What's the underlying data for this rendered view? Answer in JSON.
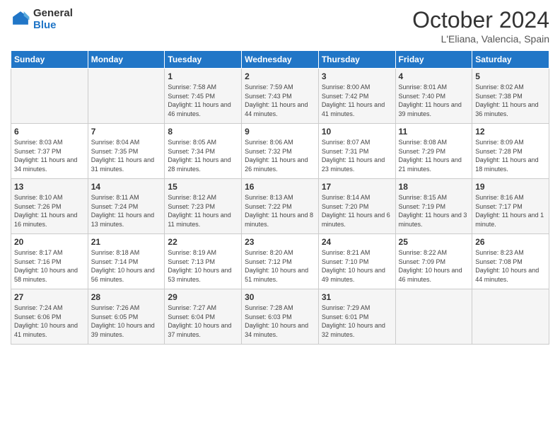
{
  "logo": {
    "line1": "General",
    "line2": "Blue"
  },
  "title": "October 2024",
  "subtitle": "L'Eliana, Valencia, Spain",
  "days_of_week": [
    "Sunday",
    "Monday",
    "Tuesday",
    "Wednesday",
    "Thursday",
    "Friday",
    "Saturday"
  ],
  "weeks": [
    [
      {
        "day": "",
        "info": ""
      },
      {
        "day": "",
        "info": ""
      },
      {
        "day": "1",
        "info": "Sunrise: 7:58 AM\nSunset: 7:45 PM\nDaylight: 11 hours and 46 minutes."
      },
      {
        "day": "2",
        "info": "Sunrise: 7:59 AM\nSunset: 7:43 PM\nDaylight: 11 hours and 44 minutes."
      },
      {
        "day": "3",
        "info": "Sunrise: 8:00 AM\nSunset: 7:42 PM\nDaylight: 11 hours and 41 minutes."
      },
      {
        "day": "4",
        "info": "Sunrise: 8:01 AM\nSunset: 7:40 PM\nDaylight: 11 hours and 39 minutes."
      },
      {
        "day": "5",
        "info": "Sunrise: 8:02 AM\nSunset: 7:38 PM\nDaylight: 11 hours and 36 minutes."
      }
    ],
    [
      {
        "day": "6",
        "info": "Sunrise: 8:03 AM\nSunset: 7:37 PM\nDaylight: 11 hours and 34 minutes."
      },
      {
        "day": "7",
        "info": "Sunrise: 8:04 AM\nSunset: 7:35 PM\nDaylight: 11 hours and 31 minutes."
      },
      {
        "day": "8",
        "info": "Sunrise: 8:05 AM\nSunset: 7:34 PM\nDaylight: 11 hours and 28 minutes."
      },
      {
        "day": "9",
        "info": "Sunrise: 8:06 AM\nSunset: 7:32 PM\nDaylight: 11 hours and 26 minutes."
      },
      {
        "day": "10",
        "info": "Sunrise: 8:07 AM\nSunset: 7:31 PM\nDaylight: 11 hours and 23 minutes."
      },
      {
        "day": "11",
        "info": "Sunrise: 8:08 AM\nSunset: 7:29 PM\nDaylight: 11 hours and 21 minutes."
      },
      {
        "day": "12",
        "info": "Sunrise: 8:09 AM\nSunset: 7:28 PM\nDaylight: 11 hours and 18 minutes."
      }
    ],
    [
      {
        "day": "13",
        "info": "Sunrise: 8:10 AM\nSunset: 7:26 PM\nDaylight: 11 hours and 16 minutes."
      },
      {
        "day": "14",
        "info": "Sunrise: 8:11 AM\nSunset: 7:24 PM\nDaylight: 11 hours and 13 minutes."
      },
      {
        "day": "15",
        "info": "Sunrise: 8:12 AM\nSunset: 7:23 PM\nDaylight: 11 hours and 11 minutes."
      },
      {
        "day": "16",
        "info": "Sunrise: 8:13 AM\nSunset: 7:22 PM\nDaylight: 11 hours and 8 minutes."
      },
      {
        "day": "17",
        "info": "Sunrise: 8:14 AM\nSunset: 7:20 PM\nDaylight: 11 hours and 6 minutes."
      },
      {
        "day": "18",
        "info": "Sunrise: 8:15 AM\nSunset: 7:19 PM\nDaylight: 11 hours and 3 minutes."
      },
      {
        "day": "19",
        "info": "Sunrise: 8:16 AM\nSunset: 7:17 PM\nDaylight: 11 hours and 1 minute."
      }
    ],
    [
      {
        "day": "20",
        "info": "Sunrise: 8:17 AM\nSunset: 7:16 PM\nDaylight: 10 hours and 58 minutes."
      },
      {
        "day": "21",
        "info": "Sunrise: 8:18 AM\nSunset: 7:14 PM\nDaylight: 10 hours and 56 minutes."
      },
      {
        "day": "22",
        "info": "Sunrise: 8:19 AM\nSunset: 7:13 PM\nDaylight: 10 hours and 53 minutes."
      },
      {
        "day": "23",
        "info": "Sunrise: 8:20 AM\nSunset: 7:12 PM\nDaylight: 10 hours and 51 minutes."
      },
      {
        "day": "24",
        "info": "Sunrise: 8:21 AM\nSunset: 7:10 PM\nDaylight: 10 hours and 49 minutes."
      },
      {
        "day": "25",
        "info": "Sunrise: 8:22 AM\nSunset: 7:09 PM\nDaylight: 10 hours and 46 minutes."
      },
      {
        "day": "26",
        "info": "Sunrise: 8:23 AM\nSunset: 7:08 PM\nDaylight: 10 hours and 44 minutes."
      }
    ],
    [
      {
        "day": "27",
        "info": "Sunrise: 7:24 AM\nSunset: 6:06 PM\nDaylight: 10 hours and 41 minutes."
      },
      {
        "day": "28",
        "info": "Sunrise: 7:26 AM\nSunset: 6:05 PM\nDaylight: 10 hours and 39 minutes."
      },
      {
        "day": "29",
        "info": "Sunrise: 7:27 AM\nSunset: 6:04 PM\nDaylight: 10 hours and 37 minutes."
      },
      {
        "day": "30",
        "info": "Sunrise: 7:28 AM\nSunset: 6:03 PM\nDaylight: 10 hours and 34 minutes."
      },
      {
        "day": "31",
        "info": "Sunrise: 7:29 AM\nSunset: 6:01 PM\nDaylight: 10 hours and 32 minutes."
      },
      {
        "day": "",
        "info": ""
      },
      {
        "day": "",
        "info": ""
      }
    ]
  ]
}
